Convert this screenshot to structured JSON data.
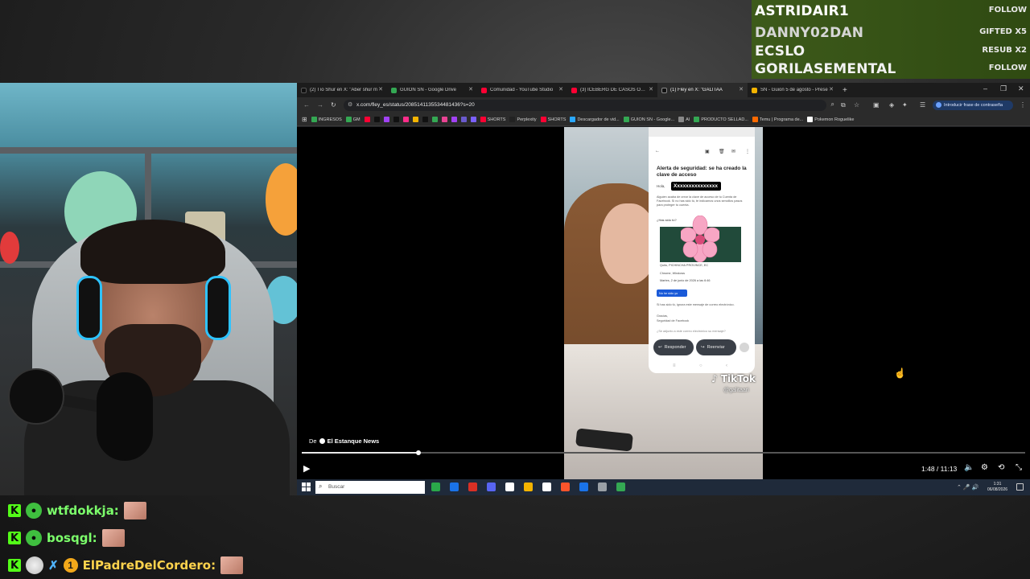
{
  "alerts": [
    {
      "name": "ASTRIDAIR1",
      "tag": "FOLLOW"
    },
    {
      "name": "DANNY02DAN",
      "tag": "GIFTED X5"
    },
    {
      "name": "ECSLO",
      "tag": "RESUB X2"
    },
    {
      "name": "GORILASEMENTAL",
      "tag": "FOLLOW"
    }
  ],
  "chat": [
    {
      "user": "wtfdokkja:"
    },
    {
      "user": "bosqgl:"
    },
    {
      "user": "ElPadreDelCordero:",
      "badge_number": "1"
    }
  ],
  "browser": {
    "tabs": [
      {
        "title": "(2) Tío Shur en X: \"Aber shur m",
        "color": "#111111"
      },
      {
        "title": "GUION SN - Google Drive",
        "color": "#34a853"
      },
      {
        "title": "Comunidad - YouTube Studio",
        "color": "#ff0033"
      },
      {
        "title": "(3) ICEBERG DE CASOS OCURR",
        "color": "#ff0033"
      },
      {
        "title": "(1) Fley en X: \"GALITAA",
        "color": "#111111"
      },
      {
        "title": "SN - Guion 5 de agosto - Prese",
        "color": "#f4b400"
      }
    ],
    "new_tab": "+",
    "window_controls": {
      "minimize": "–",
      "maximize": "❐",
      "close": "✕"
    },
    "url": "x.com/fley_es/status/2085141135534481436?s=20",
    "password_button": "Introducir frase de contraseña",
    "bookmarks": [
      {
        "label": "INGRESOS",
        "color": "#34a853"
      },
      {
        "label": "GM",
        "color": "#34a853"
      },
      {
        "label": "",
        "color": "#ff0033"
      },
      {
        "label": "",
        "color": "#111111"
      },
      {
        "label": "",
        "color": "#a142f4"
      },
      {
        "label": "",
        "color": "#111111"
      },
      {
        "label": "",
        "color": "#ff2d8a"
      },
      {
        "label": "",
        "color": "#f4b400"
      },
      {
        "label": "",
        "color": "#111111"
      },
      {
        "label": "",
        "color": "#34a853"
      },
      {
        "label": "",
        "color": "#e84393"
      },
      {
        "label": "",
        "color": "#a142f4"
      },
      {
        "label": "",
        "color": "#6a5acd"
      },
      {
        "label": "",
        "color": "#7b61ff"
      },
      {
        "label": "SHORTS",
        "color": "#ff0033"
      },
      {
        "label": "Perplexity",
        "color": "#222222"
      },
      {
        "label": "SHORTS",
        "color": "#ff0033"
      },
      {
        "label": "Descargador de vid...",
        "color": "#2aa8ff"
      },
      {
        "label": "GUION SN - Google...",
        "color": "#34a853"
      },
      {
        "label": "AI",
        "color": "#888888"
      },
      {
        "label": "PRODUCTO SELLAD...",
        "color": "#34a853"
      },
      {
        "label": "Temu | Programa de...",
        "color": "#ff6a00"
      },
      {
        "label": "Pokemon Roguelike",
        "color": "#ffffff"
      }
    ]
  },
  "email": {
    "title": "Alerta de seguridad: se ha creado la clave de acceso",
    "greeting": "Hola,",
    "redacted": "Xxxxxxxxxxxxxxx",
    "body": "Alguien acaba de crear la clave de acceso de tu Cuenta de Facebook. Si no has sido tú, te indicamos unos sencillos pasos para proteger tu cuenta.",
    "question": "¿Has sido tú?",
    "info": [
      "Quito, PICHINCHA PROVINCE, EC",
      "Chrome, Windows",
      "Martes, 2 de junio de 2026 a las 6:46"
    ],
    "no_button": "No he sido yo",
    "ignore": "Si has sido tú, ignora este mensaje de correo electrónico.",
    "sign_1": "Gracias,",
    "sign_2": "Seguridad de Facebook",
    "footer": "¿Se adjunto a este correo electrónico su mensaje?",
    "reply": "Responder",
    "forward": "Reenviar"
  },
  "video": {
    "watermark": "TikTok",
    "watermark_user": "@galitaari",
    "source_prefix": "De",
    "source_name": "El Estanque News",
    "time": "1:48 / 11:13",
    "progress": 0.161
  },
  "taskbar": {
    "search_placeholder": "Buscar",
    "clock_time": "1:31",
    "clock_date": "06/08/2026",
    "icons": [
      "#2aa84a",
      "#1a73e8",
      "#d93025",
      "#5865f2",
      "#ffffff",
      "#f4b400",
      "#ffffff",
      "#fb542b",
      "#1a73e8",
      "#9aa0a6",
      "#34a853"
    ]
  }
}
